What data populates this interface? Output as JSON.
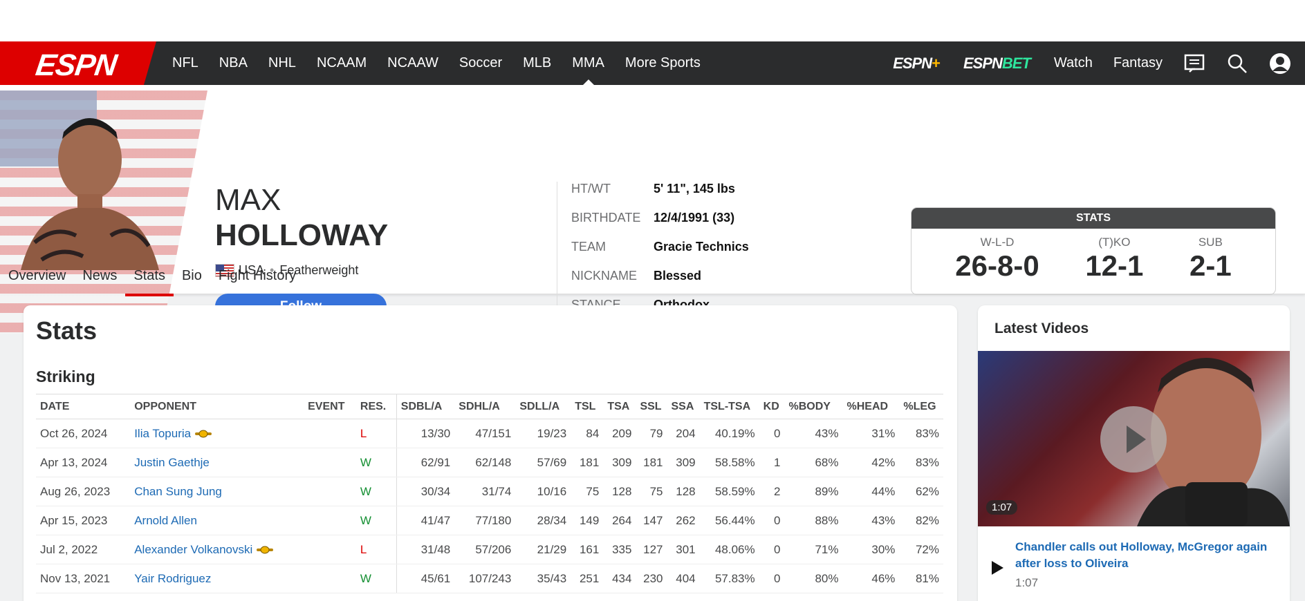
{
  "nav": {
    "logo": "ESPN",
    "links": [
      "NFL",
      "NBA",
      "NHL",
      "NCAAM",
      "NCAAW",
      "Soccer",
      "MLB",
      "MMA",
      "More Sports"
    ],
    "active_link": "MMA",
    "espn_plus": "ESPN",
    "espn_plus_mark": "+",
    "espn_bet": "ESPN",
    "espn_bet_mark": "BET",
    "watch": "Watch",
    "fantasy": "Fantasy",
    "icons": [
      "scores-icon",
      "search-icon",
      "profile-icon"
    ]
  },
  "athlete": {
    "first_name": "MAX",
    "last_name": "HOLLOWAY",
    "country": "USA",
    "division": "Featherweight",
    "follow_label": "Follow",
    "bio": [
      {
        "label": "HT/WT",
        "value": "5' 11\", 145 lbs"
      },
      {
        "label": "BIRTHDATE",
        "value": "12/4/1991 (33)"
      },
      {
        "label": "TEAM",
        "value": "Gracie Technics"
      },
      {
        "label": "NICKNAME",
        "value": "Blessed"
      },
      {
        "label": "STANCE",
        "value": "Orthodox"
      }
    ]
  },
  "stats_box": {
    "title": "STATS",
    "items": [
      {
        "label": "W-L-D",
        "value": "26-8-0"
      },
      {
        "label": "(T)KO",
        "value": "12-1"
      },
      {
        "label": "SUB",
        "value": "2-1"
      }
    ]
  },
  "subnav": {
    "items": [
      "Overview",
      "News",
      "Stats",
      "Bio",
      "Fight History"
    ],
    "active": "Stats"
  },
  "stats": {
    "title": "Stats",
    "section": "Striking",
    "columns": [
      "DATE",
      "OPPONENT",
      "EVENT",
      "RES.",
      "SDBL/A",
      "SDHL/A",
      "SDLL/A",
      "TSL",
      "TSA",
      "SSL",
      "SSA",
      "TSL-TSA",
      "KD",
      "%BODY",
      "%HEAD",
      "%LEG"
    ],
    "rows": [
      {
        "date": "Oct 26, 2024",
        "opponent": "Ilia Topuria",
        "title_fight": true,
        "event": "",
        "res": "L",
        "sdbl": "13/30",
        "sdhl": "47/151",
        "sdll": "19/23",
        "tsl": "84",
        "tsa": "209",
        "ssl": "79",
        "ssa": "204",
        "tsltsa": "40.19%",
        "kd": "0",
        "body": "43%",
        "head": "31%",
        "leg": "83%"
      },
      {
        "date": "Apr 13, 2024",
        "opponent": "Justin Gaethje",
        "title_fight": false,
        "event": "",
        "res": "W",
        "sdbl": "62/91",
        "sdhl": "62/148",
        "sdll": "57/69",
        "tsl": "181",
        "tsa": "309",
        "ssl": "181",
        "ssa": "309",
        "tsltsa": "58.58%",
        "kd": "1",
        "body": "68%",
        "head": "42%",
        "leg": "83%"
      },
      {
        "date": "Aug 26, 2023",
        "opponent": "Chan Sung Jung",
        "title_fight": false,
        "event": "",
        "res": "W",
        "sdbl": "30/34",
        "sdhl": "31/74",
        "sdll": "10/16",
        "tsl": "75",
        "tsa": "128",
        "ssl": "75",
        "ssa": "128",
        "tsltsa": "58.59%",
        "kd": "2",
        "body": "89%",
        "head": "44%",
        "leg": "62%"
      },
      {
        "date": "Apr 15, 2023",
        "opponent": "Arnold Allen",
        "title_fight": false,
        "event": "",
        "res": "W",
        "sdbl": "41/47",
        "sdhl": "77/180",
        "sdll": "28/34",
        "tsl": "149",
        "tsa": "264",
        "ssl": "147",
        "ssa": "262",
        "tsltsa": "56.44%",
        "kd": "0",
        "body": "88%",
        "head": "43%",
        "leg": "82%"
      },
      {
        "date": "Jul 2, 2022",
        "opponent": "Alexander Volkanovski",
        "title_fight": true,
        "event": "",
        "res": "L",
        "sdbl": "31/48",
        "sdhl": "57/206",
        "sdll": "21/29",
        "tsl": "161",
        "tsa": "335",
        "ssl": "127",
        "ssa": "301",
        "tsltsa": "48.06%",
        "kd": "0",
        "body": "71%",
        "head": "30%",
        "leg": "72%"
      },
      {
        "date": "Nov 13, 2021",
        "opponent": "Yair Rodriguez",
        "title_fight": false,
        "event": "",
        "res": "W",
        "sdbl": "45/61",
        "sdhl": "107/243",
        "sdll": "35/43",
        "tsl": "251",
        "tsa": "434",
        "ssl": "230",
        "ssa": "404",
        "tsltsa": "57.83%",
        "kd": "0",
        "body": "80%",
        "head": "46%",
        "leg": "81%"
      }
    ]
  },
  "videos": {
    "title": "Latest Videos",
    "featured": {
      "duration": "1:07",
      "headline": "Chandler calls out Holloway, McGregor again after loss to Oliveira",
      "duration_text": "1:07"
    }
  },
  "colors": {
    "espn_red": "#dd0000",
    "nav_bg": "#2b2c2d",
    "link_blue": "#1d6ab4",
    "win_green": "#148f32",
    "loss_red": "#dd0000",
    "follow_blue": "#3672db"
  }
}
